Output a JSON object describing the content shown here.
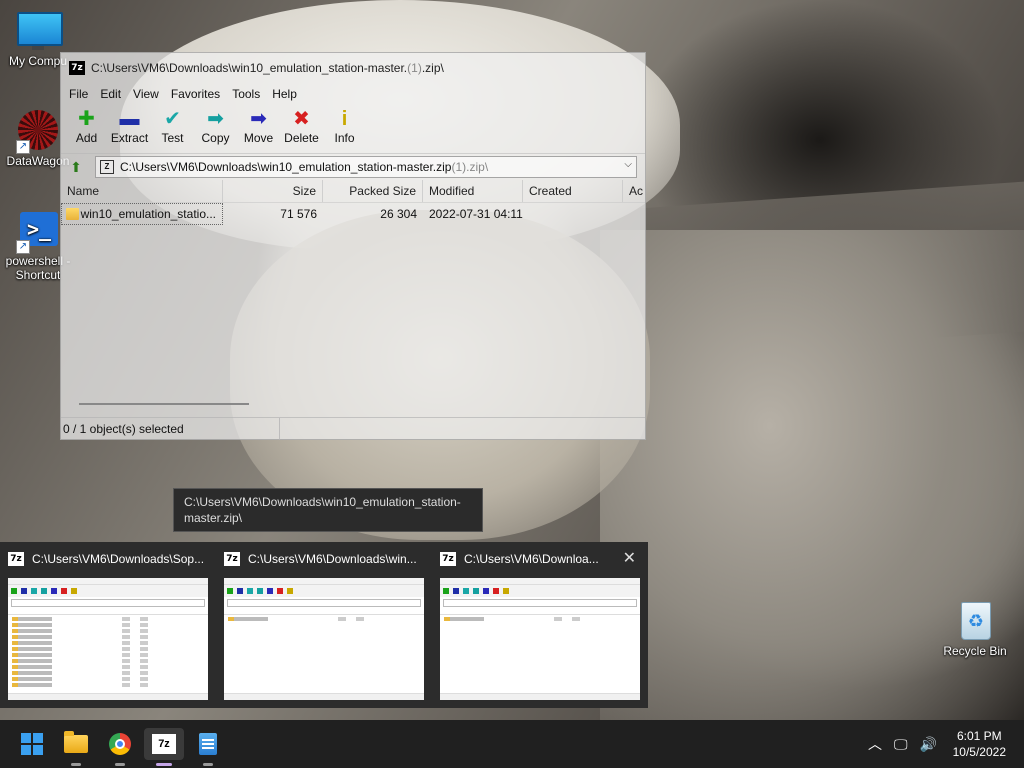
{
  "desktop": {
    "icons": [
      {
        "label": "My Compu"
      },
      {
        "label": "DataWagon"
      },
      {
        "label": "powershell - Shortcut"
      },
      {
        "label": "Recycle Bin"
      }
    ]
  },
  "window": {
    "title_path": "C:\\Users\\VM6\\Downloads\\win10_emulation_station-master.",
    "title_dim": "(1)",
    "title_ext": ".zip\\",
    "menu": [
      "File",
      "Edit",
      "View",
      "Favorites",
      "Tools",
      "Help"
    ],
    "toolbar": [
      {
        "label": "Add",
        "icon": "plus-icon",
        "glyph": "✚",
        "color": "#1aa31a"
      },
      {
        "label": "Extract",
        "icon": "minus-icon",
        "glyph": "▬",
        "color": "#1f2fa8"
      },
      {
        "label": "Test",
        "icon": "check-icon",
        "glyph": "✔",
        "color": "#1aa7a7"
      },
      {
        "label": "Copy",
        "icon": "arrow-right-icon",
        "glyph": "➡",
        "color": "#15a0a0"
      },
      {
        "label": "Move",
        "icon": "arrow-right-icon",
        "glyph": "➡",
        "color": "#2a2ab8"
      },
      {
        "label": "Delete",
        "icon": "x-icon",
        "glyph": "✖",
        "color": "#d72020"
      },
      {
        "label": "Info",
        "icon": "info-icon",
        "glyph": "i",
        "color": "#c8a800"
      }
    ],
    "address_path": "C:\\Users\\VM6\\Downloads\\win10_emulation_station-master.zip",
    "address_dim": "(1).zip\\",
    "columns": [
      "Name",
      "Size",
      "Packed Size",
      "Modified",
      "Created",
      "Ac"
    ],
    "rows": [
      {
        "name": "win10_emulation_statio...",
        "size": "71 576",
        "packed": "26 304",
        "modified": "2022-07-31 04:11",
        "created": ""
      }
    ],
    "status": "0 / 1 object(s) selected"
  },
  "tooltip": "C:\\Users\\VM6\\Downloads\\win10_emulation_station-master.zip\\",
  "thumbnails": [
    {
      "title": "C:\\Users\\VM6\\Downloads\\Sop..."
    },
    {
      "title": "C:\\Users\\VM6\\Downloads\\win..."
    },
    {
      "title": "C:\\Users\\VM6\\Downloa..."
    }
  ],
  "taskbar": {
    "apps": [
      {
        "name": "start",
        "icon": "windows-logo-icon"
      },
      {
        "name": "file-explorer",
        "icon": "folder-icon"
      },
      {
        "name": "chrome",
        "icon": "chrome-icon"
      },
      {
        "name": "7-zip",
        "icon": "sevenzip-icon",
        "label": "7z"
      },
      {
        "name": "notepad",
        "icon": "notepad-icon"
      }
    ],
    "tray": {
      "chevron": "︿",
      "network_glyph": "🖵",
      "volume_glyph": "🔊",
      "time": "6:01 PM",
      "date": "10/5/2022"
    }
  }
}
